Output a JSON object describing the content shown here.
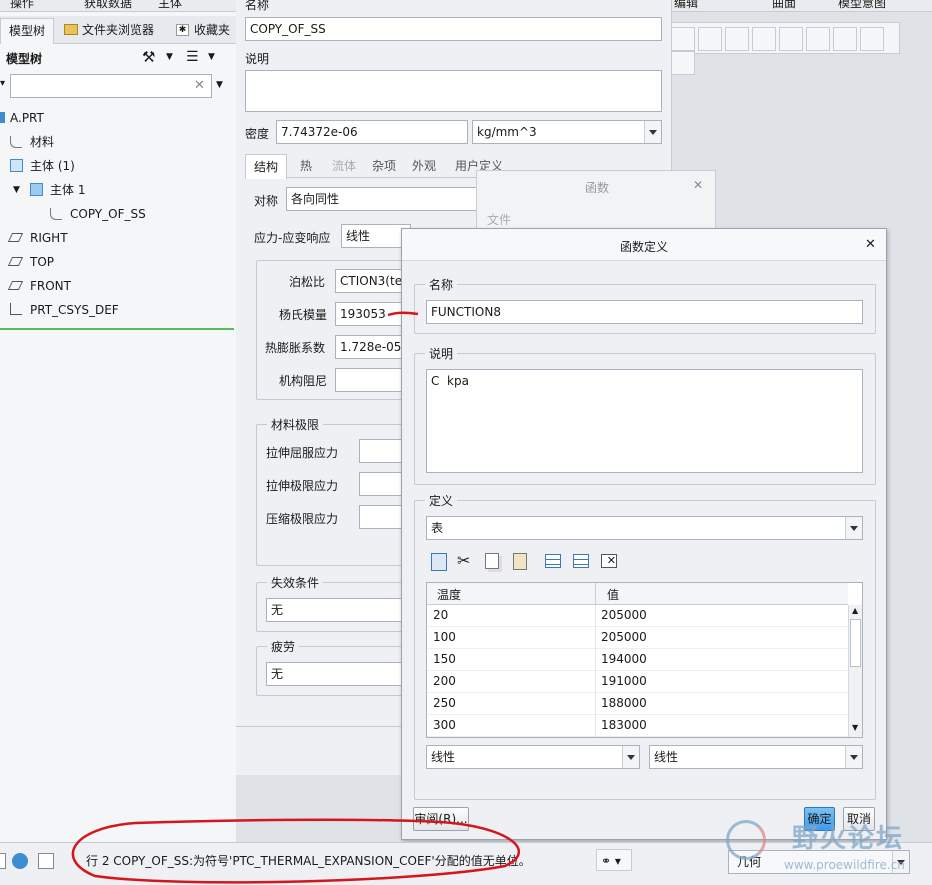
{
  "topbar": {
    "items": [
      "操作",
      "获取数据",
      "主体",
      "编辑",
      "曲面",
      "模型意图"
    ]
  },
  "left_panel": {
    "tabs": [
      "模型树",
      "文件夹浏览器",
      "收藏夹"
    ],
    "header": "模型树",
    "search_placeholder": "",
    "tree": [
      {
        "label": "A.PRT",
        "icon": "part-icon"
      },
      {
        "label": "材料",
        "icon": "material-icon"
      },
      {
        "label": "主体 (1)",
        "icon": "body-group-icon"
      },
      {
        "label": "主体 1",
        "icon": "body-icon"
      },
      {
        "label": "COPY_OF_SS",
        "icon": "material-icon"
      },
      {
        "label": "RIGHT",
        "icon": "datum-plane-icon"
      },
      {
        "label": "TOP",
        "icon": "datum-plane-icon"
      },
      {
        "label": "FRONT",
        "icon": "datum-plane-icon"
      },
      {
        "label": "PRT_CSYS_DEF",
        "icon": "csys-icon"
      }
    ]
  },
  "material_dialog": {
    "name_label": "名称",
    "name_value": "COPY_OF_SS",
    "desc_label": "说明",
    "density_label": "密度",
    "density_value": "7.74372e-06",
    "density_unit": "kg/mm^3",
    "tabs": [
      "结构",
      "热",
      "流体",
      "杂项",
      "外观",
      "用户定义"
    ],
    "symmetry_label": "对称",
    "symmetry_value": "各向同性",
    "stress_label": "应力-应变响应",
    "stress_value": "线性",
    "poisson_label": "泊松比",
    "poisson_value": "CTION3(te",
    "youngs_label": "杨氏模量",
    "youngs_value": "193053",
    "thermal_label": "热膨胀系数",
    "thermal_value": "1.728e-05",
    "damping_label": "机构阻尼",
    "limits_group": "材料极限",
    "tensile_yield_label": "拉伸屈服应力",
    "tensile_ult_label": "拉伸极限应力",
    "comp_ult_label": "压缩极限应力",
    "failure_group": "失效条件",
    "failure_value": "无",
    "fatigue_group": "疲劳",
    "fatigue_value": "无"
  },
  "function_dialog": {
    "title": "函数",
    "file_menu": "文件"
  },
  "funcdef_dialog": {
    "title": "函数定义",
    "name_group": "名称",
    "name_value": "FUNCTION8",
    "desc_group": "说明",
    "desc_value": "C  kpa",
    "def_group": "定义",
    "def_type": "表",
    "table_headers": [
      "温度",
      "值"
    ],
    "table_rows": [
      [
        "20",
        "205000"
      ],
      [
        "100",
        "205000"
      ],
      [
        "150",
        "194000"
      ],
      [
        "200",
        "191000"
      ],
      [
        "250",
        "188000"
      ],
      [
        "300",
        "183000"
      ]
    ],
    "interp_left": "线性",
    "interp_right": "线性",
    "review_button": "审阅(R)...",
    "ok_button": "确定",
    "cancel_button": "取消"
  },
  "status_bar": {
    "message": "行 2 COPY_OF_SS:为符号'PTC_THERMAL_EXPANSION_COEF'分配的值无单位。",
    "filter_value": "几何"
  },
  "watermark": {
    "text": "野火论坛",
    "url": "www.proewildfire.cn"
  },
  "colors": {
    "annotation": "#d6141c",
    "ok_button": "#3d9be9",
    "watermark": "#7fa7c9"
  }
}
